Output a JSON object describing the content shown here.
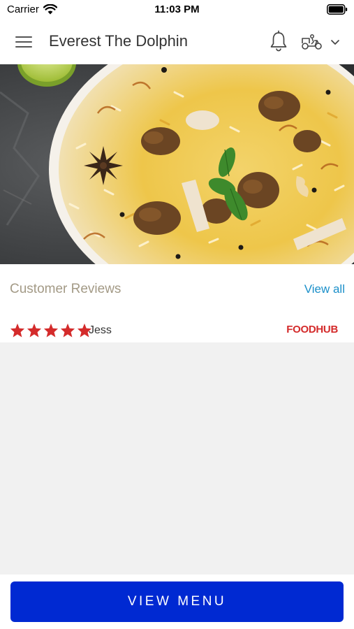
{
  "status_bar": {
    "carrier": "Carrier",
    "time": "11:03 PM",
    "wifi_icon": "wifi-icon",
    "battery_icon": "battery-icon"
  },
  "header": {
    "title": "Everest The Dolphin",
    "menu_icon": "hamburger-menu-icon",
    "notification_icon": "bell-icon",
    "order_mode_icon": "delivery-scooter-icon",
    "dropdown_icon": "chevron-down-icon"
  },
  "hero": {
    "image": "biryani-dish-photo"
  },
  "reviews": {
    "title": "Customer Reviews",
    "view_all_label": "View all",
    "items": [
      {
        "rating": 5,
        "max_rating": 5,
        "name": "Jess",
        "source": "FOODHUB"
      }
    ]
  },
  "footer": {
    "cta_label": "VIEW MENU"
  },
  "colors": {
    "accent_blue": "#0029d2",
    "link_blue": "#1a8fc9",
    "star_red": "#d42b2b",
    "section_title": "#a39a86",
    "background": "#f1f1f1"
  }
}
